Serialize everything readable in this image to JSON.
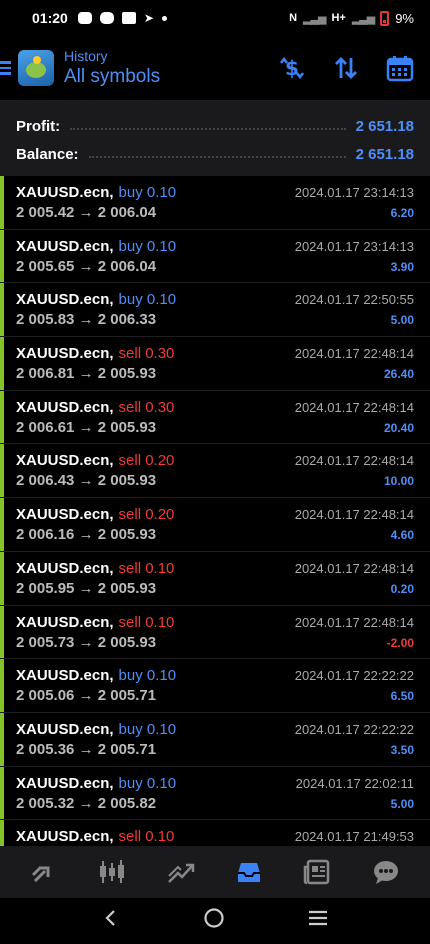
{
  "status": {
    "time": "01:20",
    "signal": "H+",
    "battery": "9%"
  },
  "header": {
    "subtitle": "History",
    "title": "All symbols"
  },
  "summary": {
    "profit_label": "Profit:",
    "profit_value": "2 651.18",
    "balance_label": "Balance:",
    "balance_value": "2 651.18"
  },
  "deals": [
    {
      "symbol": "XAUUSD.ecn,",
      "side": "buy 0.10",
      "type": "buy",
      "time": "2024.01.17 23:14:13",
      "prices": "2 005.42 → 2 006.04",
      "profit": "6.20",
      "sign": "pos"
    },
    {
      "symbol": "XAUUSD.ecn,",
      "side": "buy 0.10",
      "type": "buy",
      "time": "2024.01.17 23:14:13",
      "prices": "2 005.65 → 2 006.04",
      "profit": "3.90",
      "sign": "pos"
    },
    {
      "symbol": "XAUUSD.ecn,",
      "side": "buy 0.10",
      "type": "buy",
      "time": "2024.01.17 22:50:55",
      "prices": "2 005.83 → 2 006.33",
      "profit": "5.00",
      "sign": "pos"
    },
    {
      "symbol": "XAUUSD.ecn,",
      "side": "sell 0.30",
      "type": "sell",
      "time": "2024.01.17 22:48:14",
      "prices": "2 006.81 → 2 005.93",
      "profit": "26.40",
      "sign": "pos"
    },
    {
      "symbol": "XAUUSD.ecn,",
      "side": "sell 0.30",
      "type": "sell",
      "time": "2024.01.17 22:48:14",
      "prices": "2 006.61 → 2 005.93",
      "profit": "20.40",
      "sign": "pos"
    },
    {
      "symbol": "XAUUSD.ecn,",
      "side": "sell 0.20",
      "type": "sell",
      "time": "2024.01.17 22:48:14",
      "prices": "2 006.43 → 2 005.93",
      "profit": "10.00",
      "sign": "pos"
    },
    {
      "symbol": "XAUUSD.ecn,",
      "side": "sell 0.20",
      "type": "sell",
      "time": "2024.01.17 22:48:14",
      "prices": "2 006.16 → 2 005.93",
      "profit": "4.60",
      "sign": "pos"
    },
    {
      "symbol": "XAUUSD.ecn,",
      "side": "sell 0.10",
      "type": "sell",
      "time": "2024.01.17 22:48:14",
      "prices": "2 005.95 → 2 005.93",
      "profit": "0.20",
      "sign": "pos"
    },
    {
      "symbol": "XAUUSD.ecn,",
      "side": "sell 0.10",
      "type": "sell",
      "time": "2024.01.17 22:48:14",
      "prices": "2 005.73 → 2 005.93",
      "profit": "-2.00",
      "sign": "neg"
    },
    {
      "symbol": "XAUUSD.ecn,",
      "side": "buy 0.10",
      "type": "buy",
      "time": "2024.01.17 22:22:22",
      "prices": "2 005.06 → 2 005.71",
      "profit": "6.50",
      "sign": "pos"
    },
    {
      "symbol": "XAUUSD.ecn,",
      "side": "buy 0.10",
      "type": "buy",
      "time": "2024.01.17 22:22:22",
      "prices": "2 005.36 → 2 005.71",
      "profit": "3.50",
      "sign": "pos"
    },
    {
      "symbol": "XAUUSD.ecn,",
      "side": "buy 0.10",
      "type": "buy",
      "time": "2024.01.17 22:02:11",
      "prices": "2 005.32 → 2 005.82",
      "profit": "5.00",
      "sign": "pos"
    },
    {
      "symbol": "XAUUSD.ecn,",
      "side": "sell 0.10",
      "type": "sell",
      "time": "2024.01.17 21:49:53",
      "prices": "",
      "profit": "",
      "sign": "pos"
    }
  ],
  "colors": {
    "accent": "#4f8ff7",
    "sell": "#ef3b3b",
    "deal_marker": "#84c225",
    "panel": "#1a1a1c"
  },
  "nav_icons": [
    "quotes-icon",
    "chart-icon",
    "trade-icon",
    "history-icon",
    "news-icon",
    "chat-icon"
  ]
}
